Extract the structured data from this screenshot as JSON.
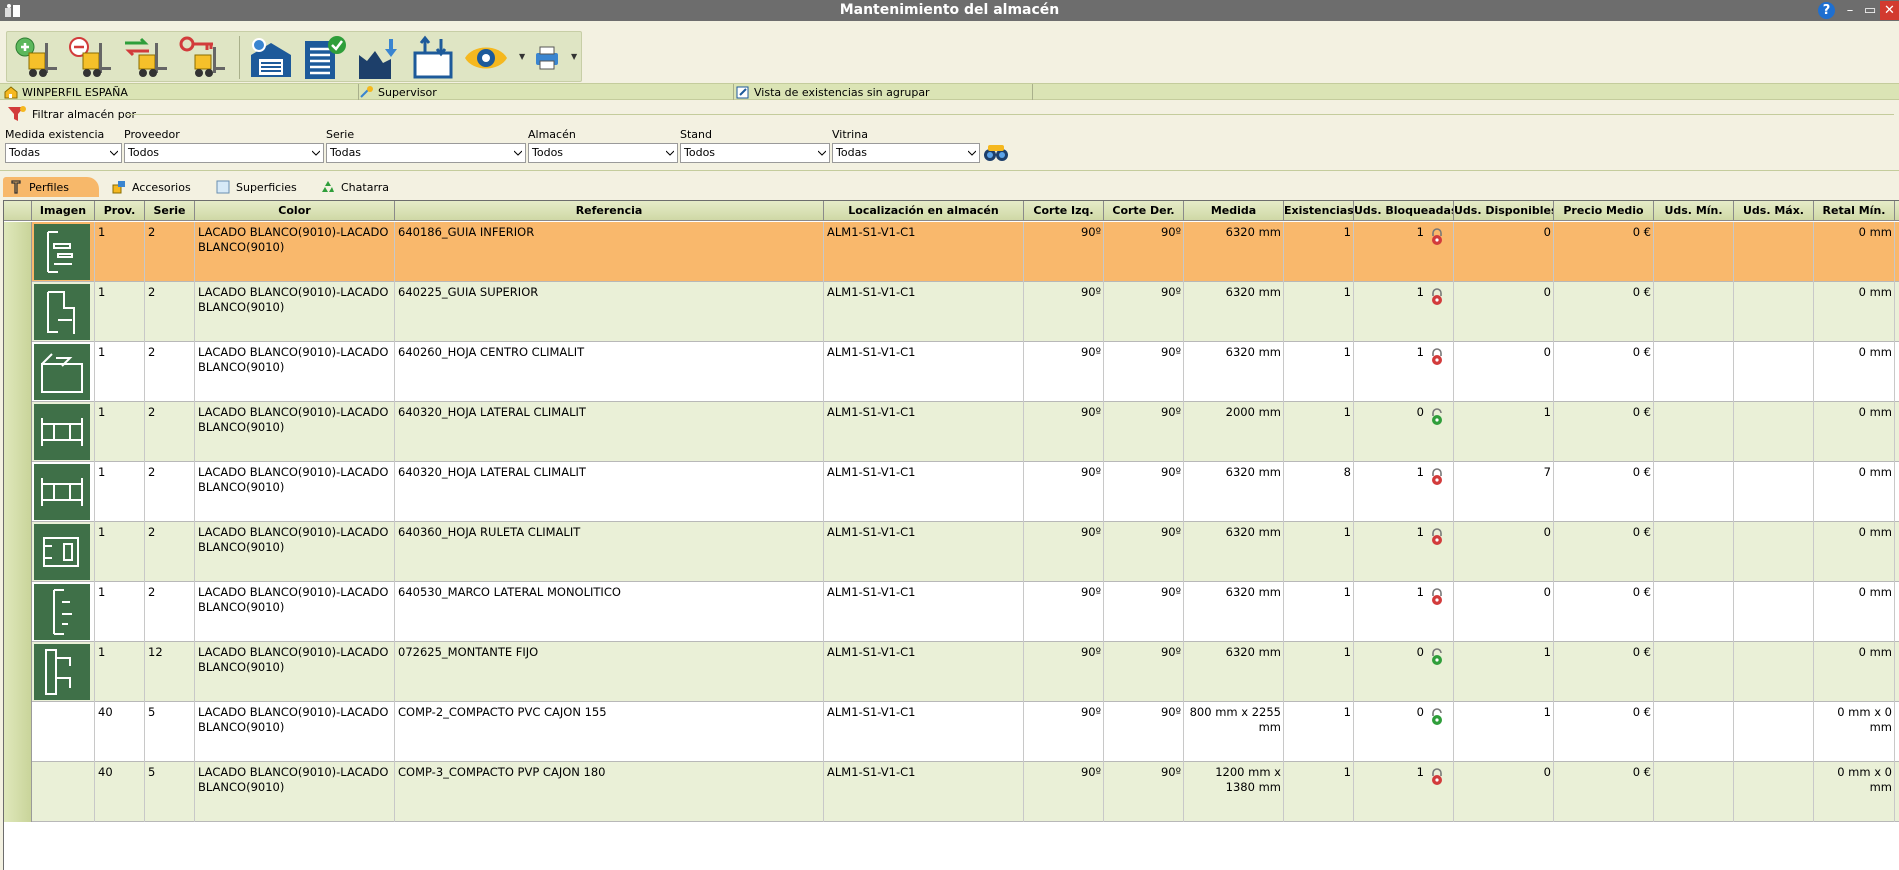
{
  "window": {
    "title": "Mantenimiento del almacén",
    "help": "?",
    "minimize": "–",
    "maximize": "▭",
    "close": "✕"
  },
  "context": {
    "company": "WINPERFIL ESPAÑA",
    "user": "Supervisor",
    "view": "Vista de existencias sin agrupar"
  },
  "filter": {
    "title": "Filtrar almacén por",
    "fields": [
      {
        "label": "Medida existencia",
        "value": "Todas"
      },
      {
        "label": "Proveedor",
        "value": "Todos"
      },
      {
        "label": "Serie",
        "value": "Todas"
      },
      {
        "label": "Almacén",
        "value": "Todos"
      },
      {
        "label": "Stand",
        "value": "Todos"
      },
      {
        "label": "Vitrina",
        "value": "Todas"
      }
    ]
  },
  "tabs": [
    "Perfiles",
    "Accesorios",
    "Superficies",
    "Chatarra"
  ],
  "grid": {
    "headers": [
      "Imagen",
      "Prov.",
      "Serie",
      "Color",
      "Referencia",
      "Localización en almacén",
      "Corte Izq.",
      "Corte Der.",
      "Medida",
      "Existencias",
      "Uds. Bloqueadas",
      "Uds. Disponibles",
      "Precio Medio",
      "Uds. Mín.",
      "Uds. Máx.",
      "Retal Mín."
    ],
    "rows": [
      {
        "prov": "1",
        "serie": "2",
        "color": " LACADO BLANCO(9010)-LACADO BLANCO(9010)",
        "ref": "640186_GUIA INFERIOR",
        "loc": "ALM1-S1-V1-C1",
        "ci": "90º",
        "cd": "90º",
        "medida": "6320 mm",
        "exist": "1",
        "bloq": "1",
        "locked": true,
        "disp": "0",
        "precio": "0 €",
        "min": "",
        "max": "",
        "retal": "0 mm",
        "img": "a"
      },
      {
        "prov": "1",
        "serie": "2",
        "color": " LACADO BLANCO(9010)-LACADO BLANCO(9010)",
        "ref": "640225_GUIA SUPERIOR",
        "loc": "ALM1-S1-V1-C1",
        "ci": "90º",
        "cd": "90º",
        "medida": "6320 mm",
        "exist": "1",
        "bloq": "1",
        "locked": true,
        "disp": "0",
        "precio": "0 €",
        "min": "",
        "max": "",
        "retal": "0 mm",
        "img": "b"
      },
      {
        "prov": "1",
        "serie": "2",
        "color": " LACADO BLANCO(9010)-LACADO BLANCO(9010)",
        "ref": "640260_HOJA CENTRO CLIMALIT",
        "loc": "ALM1-S1-V1-C1",
        "ci": "90º",
        "cd": "90º",
        "medida": "6320 mm",
        "exist": "1",
        "bloq": "1",
        "locked": true,
        "disp": "0",
        "precio": "0 €",
        "min": "",
        "max": "",
        "retal": "0 mm",
        "img": "c"
      },
      {
        "prov": "1",
        "serie": "2",
        "color": " LACADO BLANCO(9010)-LACADO BLANCO(9010)",
        "ref": "640320_HOJA LATERAL CLIMALIT",
        "loc": "ALM1-S1-V1-C1",
        "ci": "90º",
        "cd": "90º",
        "medida": "2000 mm",
        "exist": "1",
        "bloq": "0",
        "locked": false,
        "disp": "1",
        "precio": "0 €",
        "min": "",
        "max": "",
        "retal": "0 mm",
        "img": "d"
      },
      {
        "prov": "1",
        "serie": "2",
        "color": " LACADO BLANCO(9010)-LACADO BLANCO(9010)",
        "ref": "640320_HOJA LATERAL CLIMALIT",
        "loc": "ALM1-S1-V1-C1",
        "ci": "90º",
        "cd": "90º",
        "medida": "6320 mm",
        "exist": "8",
        "bloq": "1",
        "locked": true,
        "disp": "7",
        "precio": "0 €",
        "min": "",
        "max": "",
        "retal": "0 mm",
        "img": "d"
      },
      {
        "prov": "1",
        "serie": "2",
        "color": " LACADO BLANCO(9010)-LACADO BLANCO(9010)",
        "ref": "640360_HOJA RULETA CLIMALIT",
        "loc": "ALM1-S1-V1-C1",
        "ci": "90º",
        "cd": "90º",
        "medida": "6320 mm",
        "exist": "1",
        "bloq": "1",
        "locked": true,
        "disp": "0",
        "precio": "0 €",
        "min": "",
        "max": "",
        "retal": "0 mm",
        "img": "e"
      },
      {
        "prov": "1",
        "serie": "2",
        "color": " LACADO BLANCO(9010)-LACADO BLANCO(9010)",
        "ref": "640530_MARCO LATERAL MONOLITICO",
        "loc": "ALM1-S1-V1-C1",
        "ci": "90º",
        "cd": "90º",
        "medida": "6320 mm",
        "exist": "1",
        "bloq": "1",
        "locked": true,
        "disp": "0",
        "precio": "0 €",
        "min": "",
        "max": "",
        "retal": "0 mm",
        "img": "f"
      },
      {
        "prov": "1",
        "serie": "12",
        "color": " LACADO BLANCO(9010)-LACADO BLANCO(9010)",
        "ref": "072625_MONTANTE FIJO",
        "loc": "ALM1-S1-V1-C1",
        "ci": "90º",
        "cd": "90º",
        "medida": "6320 mm",
        "exist": "1",
        "bloq": "0",
        "locked": false,
        "disp": "1",
        "precio": "0 €",
        "min": "",
        "max": "",
        "retal": "0 mm",
        "img": "g"
      },
      {
        "prov": "40",
        "serie": "5",
        "color": " LACADO BLANCO(9010)-LACADO BLANCO(9010)",
        "ref": "COMP-2_COMPACTO PVC CAJON 155",
        "loc": "ALM1-S1-V1-C1",
        "ci": "90º",
        "cd": "90º",
        "medida": "800 mm x 2255 mm",
        "exist": "1",
        "bloq": "0",
        "locked": false,
        "disp": "1",
        "precio": "0 €",
        "min": "",
        "max": "",
        "retal": "0 mm x 0 mm",
        "img": ""
      },
      {
        "prov": "40",
        "serie": "5",
        "color": " LACADO BLANCO(9010)-LACADO BLANCO(9010)",
        "ref": "COMP-3_COMPACTO PVP CAJON 180",
        "loc": "ALM1-S1-V1-C1",
        "ci": "90º",
        "cd": "90º",
        "medida": "1200 mm x 1380 mm",
        "exist": "1",
        "bloq": "1",
        "locked": true,
        "disp": "0",
        "precio": "0 €",
        "min": "",
        "max": "",
        "retal": "0 mm x 0 mm",
        "img": ""
      }
    ]
  },
  "colors": {
    "selected_row": "#f9b86c",
    "alt_row": "#eaf0d7",
    "lock_red": "#d23b3b",
    "lock_green": "#2f9e3a",
    "thumb_bg": "#3f7048"
  }
}
